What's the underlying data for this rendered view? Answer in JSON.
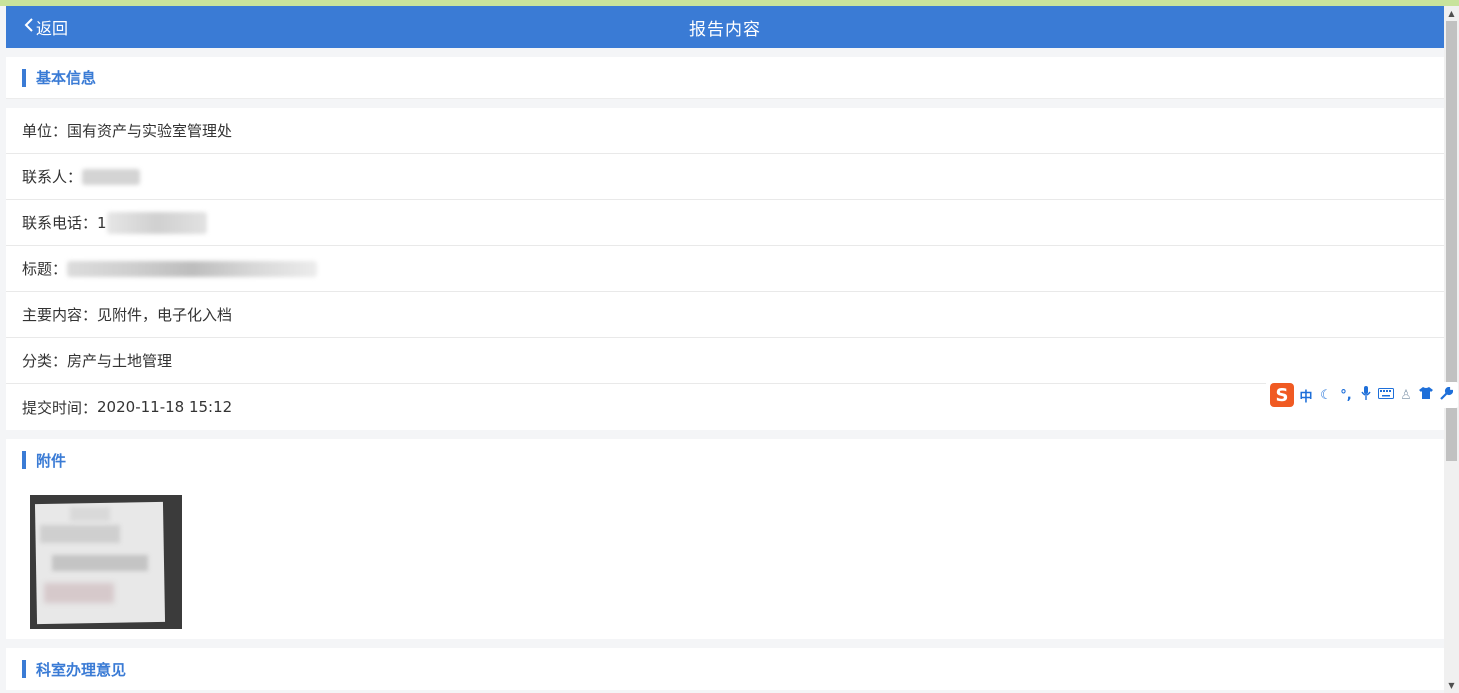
{
  "header": {
    "back_label": "返回",
    "title": "报告内容"
  },
  "basic_info": {
    "section_label": "基本信息",
    "rows": [
      {
        "label": "单位：",
        "value": "国有资产与实验室管理处"
      },
      {
        "label": "联系人：",
        "value": ""
      },
      {
        "label": "联系电话：",
        "value": "1"
      },
      {
        "label": "标题：",
        "value": ""
      },
      {
        "label": "主要内容：",
        "value": "见附件，电子化入档"
      },
      {
        "label": "分类：",
        "value": "房产与土地管理"
      },
      {
        "label": "提交时间：",
        "value": "2020-11-18 15:12"
      }
    ]
  },
  "attachments": {
    "section_label": "附件"
  },
  "opinion": {
    "section_label": "科室办理意见"
  },
  "ime_toolbar": {
    "logo": "S",
    "mode": "中",
    "icons": [
      "moon-icon",
      "punctuation-icon",
      "microphone-icon",
      "keyboard-icon",
      "user-icon",
      "shirt-icon",
      "wrench-icon"
    ]
  },
  "colors": {
    "accent": "#3a7bd5",
    "ime_logo": "#f05a22"
  }
}
